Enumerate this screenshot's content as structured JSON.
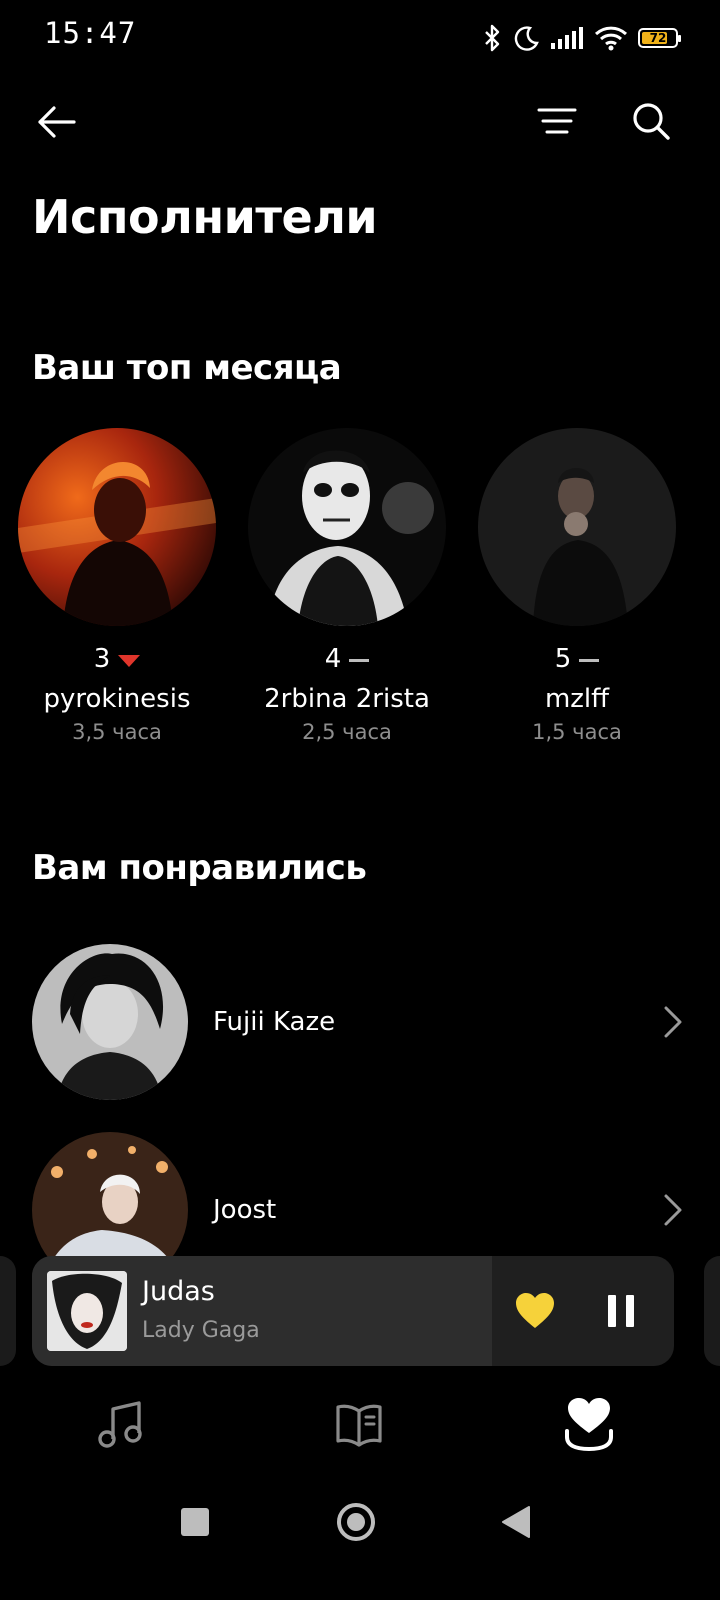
{
  "status_bar": {
    "time": "15:47",
    "battery": "72",
    "icons": [
      "bluetooth-icon",
      "moon-icon",
      "signal-icon",
      "wifi-icon",
      "battery-icon"
    ]
  },
  "top_bar": {
    "icons": [
      "back-arrow-icon",
      "sort-icon",
      "search-icon"
    ]
  },
  "page": {
    "title": "Исполнители"
  },
  "top_month": {
    "title": "Ваш топ месяца",
    "artists": [
      {
        "rank": "3",
        "trend": "down",
        "name": "pyrokinesis",
        "time": "3,5 часа"
      },
      {
        "rank": "4",
        "trend": "same",
        "name": "2rbina 2rista",
        "time": "2,5 часа"
      },
      {
        "rank": "5",
        "trend": "same",
        "name": "mzlff",
        "time": "1,5 часа"
      }
    ]
  },
  "liked": {
    "title": "Вам понравились",
    "artists": [
      {
        "name": "Fujii Kaze"
      },
      {
        "name": "Joost"
      }
    ]
  },
  "player": {
    "track": "Judas",
    "artist": "Lady Gaga",
    "liked_color": "#f6d23a",
    "icons": [
      "like-heart-icon",
      "pause-icon"
    ]
  },
  "bottom_nav": {
    "icons": [
      "music-note-icon",
      "library-book-icon",
      "collection-heart-icon"
    ],
    "active": "collection-heart-icon"
  },
  "system_nav": {
    "icons": [
      "recents-square-icon",
      "home-circle-icon",
      "back-triangle-icon"
    ]
  },
  "colors": {
    "background": "#000000",
    "accent_red": "#e0352b",
    "secondary_text": "#8e8e8e",
    "battery": "#f0b21a"
  }
}
